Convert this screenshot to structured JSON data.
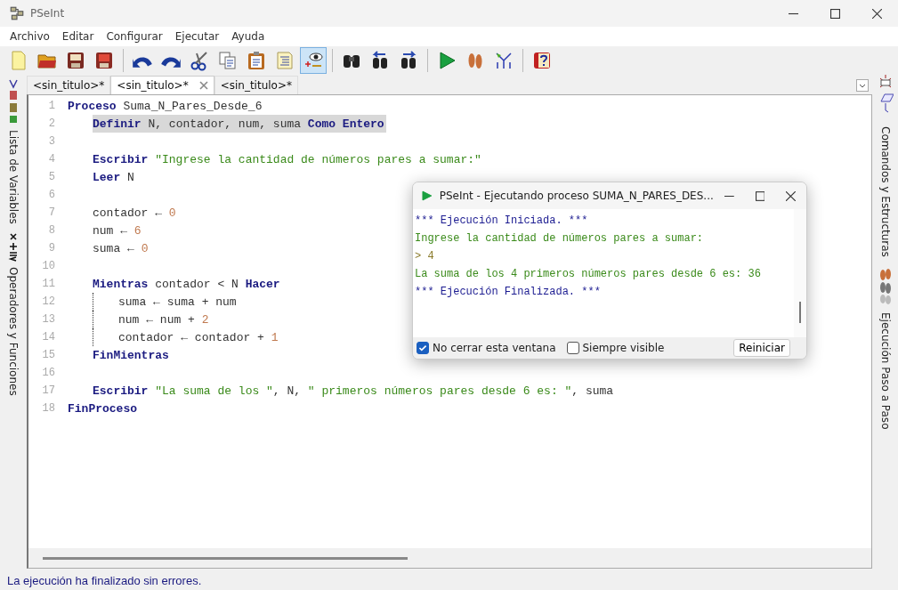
{
  "window": {
    "title": "PSeInt"
  },
  "menu": [
    "Archivo",
    "Editar",
    "Configurar",
    "Ejecutar",
    "Ayuda"
  ],
  "toolbar": [
    [
      {
        "kind": "new",
        "selected": false
      },
      {
        "kind": "open",
        "selected": false
      },
      {
        "kind": "save",
        "selected": false
      },
      {
        "kind": "saveas",
        "selected": false
      }
    ],
    [
      {
        "kind": "undo",
        "selected": false
      },
      {
        "kind": "redo",
        "selected": false
      },
      {
        "kind": "cut",
        "selected": false
      },
      {
        "kind": "copy",
        "selected": false
      },
      {
        "kind": "paste",
        "selected": false
      },
      {
        "kind": "indent",
        "selected": false
      },
      {
        "kind": "inspect",
        "selected": true
      }
    ],
    [
      {
        "kind": "find",
        "selected": false
      },
      {
        "kind": "findprev",
        "selected": false
      },
      {
        "kind": "findnext",
        "selected": false
      }
    ],
    [
      {
        "kind": "run",
        "selected": false
      },
      {
        "kind": "step",
        "selected": false
      },
      {
        "kind": "flow",
        "selected": false
      }
    ],
    [
      {
        "kind": "help",
        "selected": false
      }
    ]
  ],
  "tabs": [
    {
      "label": "<sin_titulo>*",
      "selected": false
    },
    {
      "label": "<sin_titulo>*",
      "selected": true
    },
    {
      "label": "<sin_titulo>*",
      "selected": false
    }
  ],
  "left_panel": [
    {
      "kind": "variables",
      "label": "Lista de Variables"
    },
    {
      "kind": "operators",
      "label": "Operadores y Funciones"
    }
  ],
  "right_panel": [
    {
      "kind": "commands",
      "label": "Comandos y Estructuras"
    },
    {
      "kind": "steps",
      "label": "Ejecución Paso a Paso"
    }
  ],
  "code": [
    {
      "number": "1",
      "highlighted": false,
      "tokens": [
        {
          "kind": "kw",
          "text": "Proceso "
        },
        {
          "kind": "id",
          "text": "Suma_N_Pares_Desde_6"
        }
      ],
      "children": [
        {
          "number": "2",
          "highlighted": true,
          "tokens": [
            {
              "kind": "kw",
              "text": "Definir "
            },
            {
              "kind": "id",
              "text": "N, contador, num, suma "
            },
            {
              "kind": "kw",
              "text": "Como Entero"
            }
          ]
        },
        {
          "number": "3",
          "highlighted": false
        },
        {
          "number": "4",
          "highlighted": false,
          "tokens": [
            {
              "kind": "kw",
              "text": "Escribir "
            },
            {
              "kind": "str",
              "text": "\"Ingrese la cantidad de números pares a sumar:\""
            }
          ]
        },
        {
          "number": "5",
          "highlighted": false,
          "tokens": [
            {
              "kind": "kw",
              "text": "Leer "
            },
            {
              "kind": "id",
              "text": "N"
            }
          ]
        },
        {
          "number": "6",
          "highlighted": false
        },
        {
          "number": "7",
          "highlighted": false,
          "tokens": [
            {
              "kind": "id",
              "text": "contador "
            },
            {
              "kind": "op",
              "text": "← "
            },
            {
              "kind": "num",
              "text": "0"
            }
          ]
        },
        {
          "number": "8",
          "highlighted": false,
          "tokens": [
            {
              "kind": "id",
              "text": "num "
            },
            {
              "kind": "op",
              "text": "← "
            },
            {
              "kind": "num",
              "text": "6"
            }
          ]
        },
        {
          "number": "9",
          "highlighted": false,
          "tokens": [
            {
              "kind": "id",
              "text": "suma "
            },
            {
              "kind": "op",
              "text": "← "
            },
            {
              "kind": "num",
              "text": "0"
            }
          ]
        },
        {
          "number": "10",
          "highlighted": false
        },
        {
          "number": "11",
          "highlighted": false,
          "tokens": [
            {
              "kind": "kw",
              "text": "Mientras "
            },
            {
              "kind": "id",
              "text": "contador < N "
            },
            {
              "kind": "kw",
              "text": "Hacer"
            }
          ],
          "children": [
            {
              "number": "12",
              "highlighted": false,
              "tokens": [
                {
                  "kind": "id",
                  "text": "suma "
                },
                {
                  "kind": "op",
                  "text": "← "
                },
                {
                  "kind": "id",
                  "text": "suma + num"
                }
              ]
            },
            {
              "number": "13",
              "highlighted": false,
              "tokens": [
                {
                  "kind": "id",
                  "text": "num "
                },
                {
                  "kind": "op",
                  "text": "← "
                },
                {
                  "kind": "id",
                  "text": "num + "
                },
                {
                  "kind": "num",
                  "text": "2"
                }
              ]
            },
            {
              "number": "14",
              "highlighted": false,
              "tokens": [
                {
                  "kind": "id",
                  "text": "contador "
                },
                {
                  "kind": "op",
                  "text": "← "
                },
                {
                  "kind": "id",
                  "text": "contador + "
                },
                {
                  "kind": "num",
                  "text": "1"
                }
              ]
            }
          ]
        },
        {
          "number": "15",
          "highlighted": false,
          "tokens": [
            {
              "kind": "kw",
              "text": "FinMientras"
            }
          ]
        },
        {
          "number": "16",
          "highlighted": false
        },
        {
          "number": "17",
          "highlighted": false,
          "tokens": [
            {
              "kind": "kw",
              "text": "Escribir "
            },
            {
              "kind": "str",
              "text": "\"La suma de los \""
            },
            {
              "kind": "id",
              "text": ", N, "
            },
            {
              "kind": "str",
              "text": "\" primeros números pares desde 6 es: \""
            },
            {
              "kind": "id",
              "text": ", suma"
            }
          ]
        }
      ]
    },
    {
      "number": "18",
      "highlighted": false,
      "tokens": [
        {
          "kind": "kw",
          "text": "FinProceso"
        }
      ]
    }
  ],
  "run_window": {
    "title": "PSeInt - Ejecutando proceso SUMA_N_PARES_DES...",
    "lines": [
      {
        "kind": "system",
        "text": "*** Ejecución Iniciada. ***"
      },
      {
        "kind": "output",
        "text": "Ingrese la cantidad de números pares a sumar:"
      },
      {
        "kind": "input",
        "text": "> 4"
      },
      {
        "kind": "output",
        "text": "La suma de los 4 primeros números pares desde 6 es: 36"
      },
      {
        "kind": "system",
        "text": "*** Ejecución Finalizada. ***"
      }
    ],
    "options": [
      {
        "label": "No cerrar esta ventana",
        "checked": true
      },
      {
        "label": "Siempre visible",
        "checked": false
      }
    ],
    "button": "Reiniciar"
  },
  "status_bar": "La ejecución ha finalizado sin errores."
}
